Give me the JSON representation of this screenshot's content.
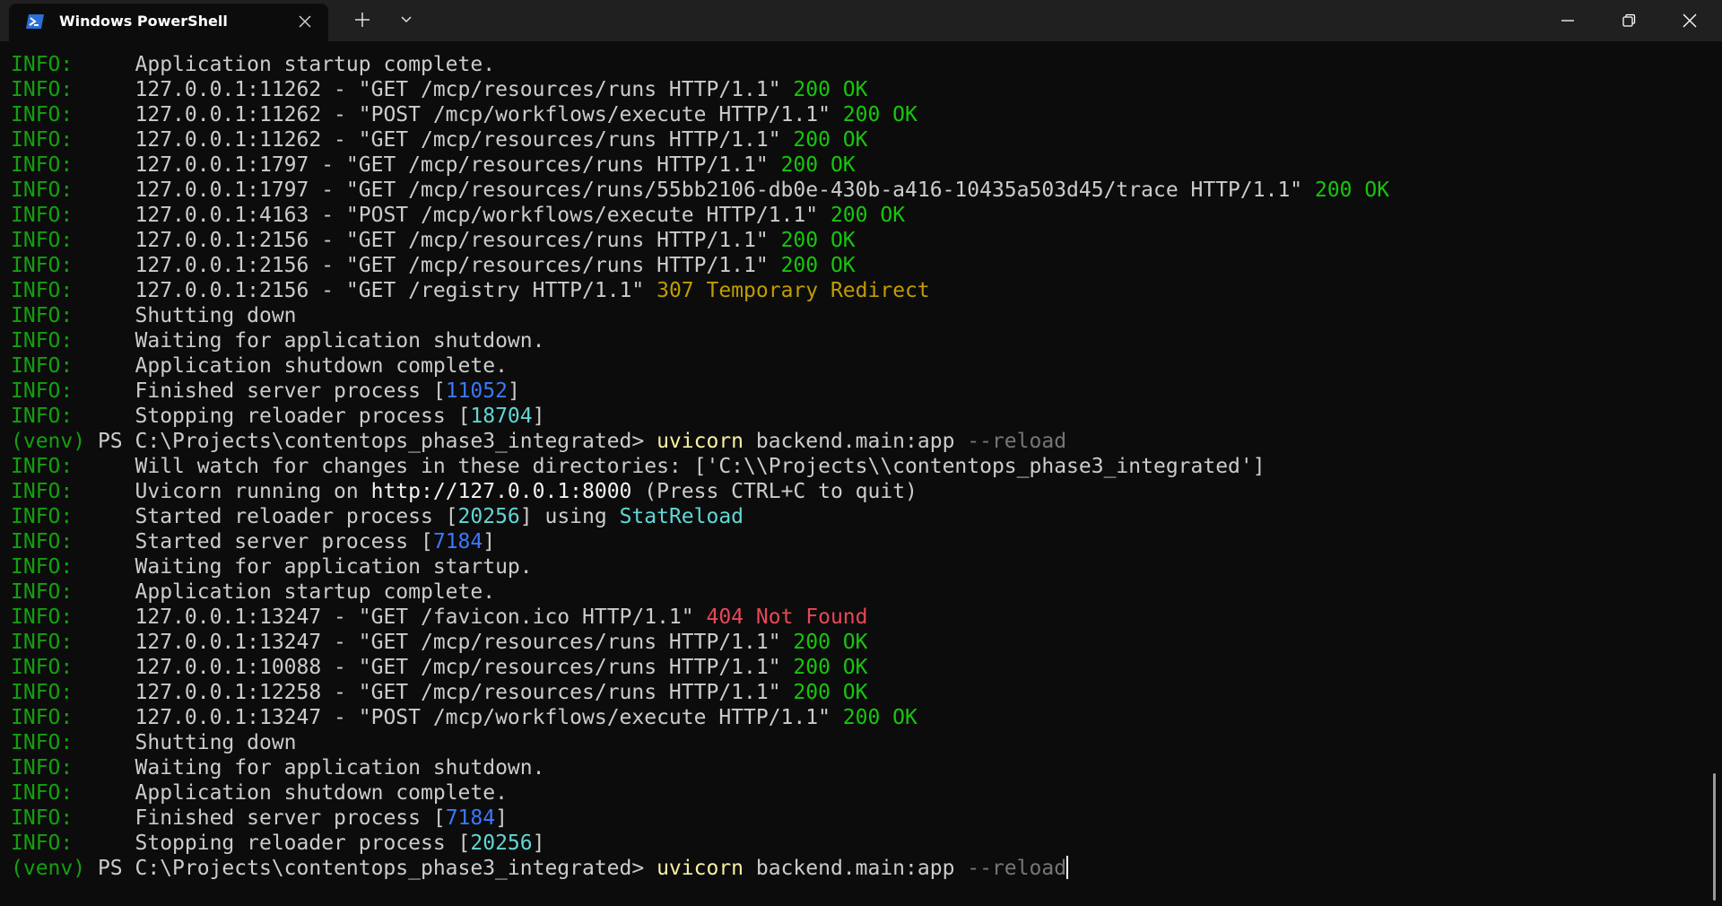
{
  "window": {
    "tab_title": "Windows PowerShell",
    "tab_icon": "powershell-icon",
    "new_tab_icon": "plus-icon",
    "dropdown_icon": "chevron-down-icon",
    "controls": [
      "minimize-icon",
      "restore-icon",
      "close-icon"
    ]
  },
  "colors": {
    "background": "#0c0c0c",
    "titlebar": "#202020",
    "level": "#13a10e",
    "ok": "#16c60c",
    "redirect": "#c19c00",
    "not_found": "#e74856",
    "pid": "#3b78ff",
    "cyan": "#61d6d6",
    "command": "#f9f1a5"
  },
  "terminal": {
    "level_label": "INFO:",
    "lines": [
      {
        "type": "info",
        "msg": "Application startup complete."
      },
      {
        "type": "req",
        "msg": "127.0.0.1:11262 - \"GET /mcp/resources/runs HTTP/1.1\" ",
        "status": "200 OK",
        "status_class": "ok"
      },
      {
        "type": "req",
        "msg": "127.0.0.1:11262 - \"POST /mcp/workflows/execute HTTP/1.1\" ",
        "status": "200 OK",
        "status_class": "ok"
      },
      {
        "type": "req",
        "msg": "127.0.0.1:11262 - \"GET /mcp/resources/runs HTTP/1.1\" ",
        "status": "200 OK",
        "status_class": "ok"
      },
      {
        "type": "req",
        "msg": "127.0.0.1:1797 - \"GET /mcp/resources/runs HTTP/1.1\" ",
        "status": "200 OK",
        "status_class": "ok"
      },
      {
        "type": "req",
        "msg": "127.0.0.1:1797 - \"GET /mcp/resources/runs/55bb2106-db0e-430b-a416-10435a503d45/trace HTTP/1.1\" ",
        "status": "200 OK",
        "status_class": "ok"
      },
      {
        "type": "req",
        "msg": "127.0.0.1:4163 - \"POST /mcp/workflows/execute HTTP/1.1\" ",
        "status": "200 OK",
        "status_class": "ok"
      },
      {
        "type": "req",
        "msg": "127.0.0.1:2156 - \"GET /mcp/resources/runs HTTP/1.1\" ",
        "status": "200 OK",
        "status_class": "ok"
      },
      {
        "type": "req",
        "msg": "127.0.0.1:2156 - \"GET /mcp/resources/runs HTTP/1.1\" ",
        "status": "200 OK",
        "status_class": "ok"
      },
      {
        "type": "req",
        "msg": "127.0.0.1:2156 - \"GET /registry HTTP/1.1\" ",
        "status": "307 Temporary Redirect",
        "status_class": "redirect"
      },
      {
        "type": "info",
        "msg": "Shutting down"
      },
      {
        "type": "info",
        "msg": "Waiting for application shutdown."
      },
      {
        "type": "info",
        "msg": "Application shutdown complete."
      },
      {
        "type": "pid",
        "msg": "Finished server process [",
        "pid": "11052",
        "pid_class": "pid",
        "after": "]"
      },
      {
        "type": "pid",
        "msg": "Stopping reloader process [",
        "pid": "18704",
        "pid_class": "pid2",
        "after": "]"
      },
      {
        "type": "prompt",
        "venv": "(venv)",
        "ps": " PS C:\\Projects\\contentops_phase3_integrated> ",
        "cmd": "uvicorn",
        "arg": " backend.main:app ",
        "flag": "--reload",
        "cursor": false
      },
      {
        "type": "info",
        "msg": "Will watch for changes in these directories: ['C:\\\\Projects\\\\contentops_phase3_integrated']"
      },
      {
        "type": "uvicorn",
        "pre": "Uvicorn running on ",
        "url": "http://127.0.0.1:8000",
        "post": " (Press CTRL+C to quit)"
      },
      {
        "type": "reloader",
        "msg": "Started reloader process [",
        "pid": "20256",
        "mid": "] using ",
        "tool": "StatReload"
      },
      {
        "type": "pid",
        "msg": "Started server process [",
        "pid": "7184",
        "pid_class": "pid",
        "after": "]"
      },
      {
        "type": "info",
        "msg": "Waiting for application startup."
      },
      {
        "type": "info",
        "msg": "Application startup complete."
      },
      {
        "type": "req",
        "msg": "127.0.0.1:13247 - \"GET /favicon.ico HTTP/1.1\" ",
        "status": "404 Not Found",
        "status_class": "notfound"
      },
      {
        "type": "req",
        "msg": "127.0.0.1:13247 - \"GET /mcp/resources/runs HTTP/1.1\" ",
        "status": "200 OK",
        "status_class": "ok"
      },
      {
        "type": "req",
        "msg": "127.0.0.1:10088 - \"GET /mcp/resources/runs HTTP/1.1\" ",
        "status": "200 OK",
        "status_class": "ok"
      },
      {
        "type": "req",
        "msg": "127.0.0.1:12258 - \"GET /mcp/resources/runs HTTP/1.1\" ",
        "status": "200 OK",
        "status_class": "ok"
      },
      {
        "type": "req",
        "msg": "127.0.0.1:13247 - \"POST /mcp/workflows/execute HTTP/1.1\" ",
        "status": "200 OK",
        "status_class": "ok"
      },
      {
        "type": "info",
        "msg": "Shutting down"
      },
      {
        "type": "info",
        "msg": "Waiting for application shutdown."
      },
      {
        "type": "info",
        "msg": "Application shutdown complete."
      },
      {
        "type": "pid",
        "msg": "Finished server process [",
        "pid": "7184",
        "pid_class": "pid",
        "after": "]"
      },
      {
        "type": "pid",
        "msg": "Stopping reloader process [",
        "pid": "20256",
        "pid_class": "pid2",
        "after": "]"
      },
      {
        "type": "prompt",
        "venv": "(venv)",
        "ps": " PS C:\\Projects\\contentops_phase3_integrated> ",
        "cmd": "uvicorn",
        "arg": " backend.main:app ",
        "flag": "--reload",
        "cursor": true
      }
    ]
  }
}
